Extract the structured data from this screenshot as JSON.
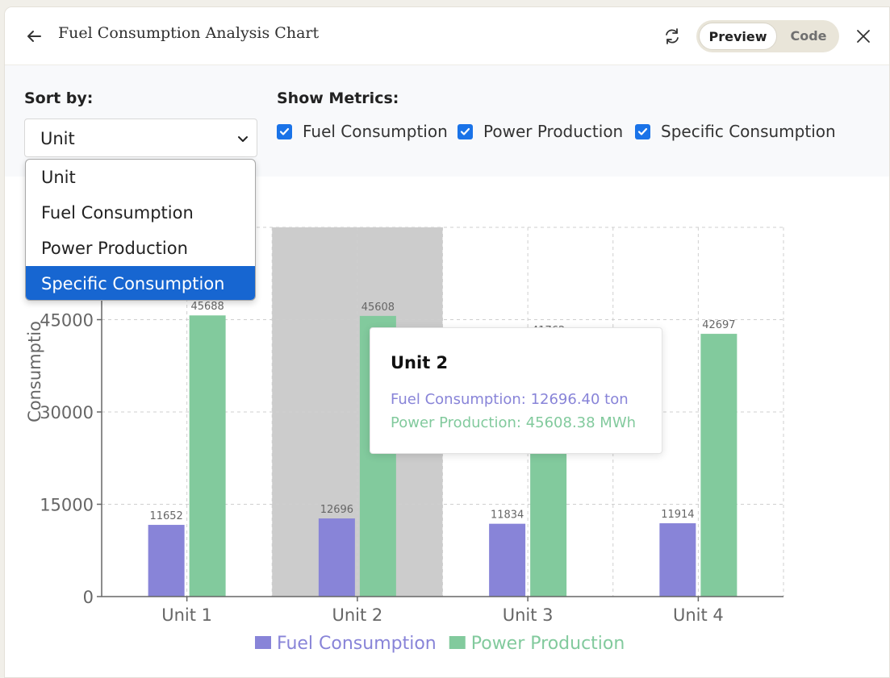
{
  "header": {
    "title": "Fuel Consumption Analysis Chart",
    "toggle": {
      "preview": "Preview",
      "code": "Code"
    }
  },
  "controls": {
    "sort_label": "Sort by:",
    "sort_value": "Unit",
    "sort_options": [
      "Unit",
      "Fuel Consumption",
      "Power Production",
      "Specific Consumption"
    ],
    "highlighted_option": "Specific Consumption",
    "metrics_label": "Show Metrics:",
    "metrics": [
      {
        "label": "Fuel Consumption",
        "checked": true
      },
      {
        "label": "Power Production",
        "checked": true
      },
      {
        "label": "Specific Consumption",
        "checked": true
      }
    ]
  },
  "tooltip": {
    "title": "Unit 2",
    "fuel_line": "Fuel Consumption: 12696.40 ton",
    "power_line": "Power Production: 45608.38 MWh"
  },
  "chart_data": {
    "type": "bar",
    "categories": [
      "Unit 1",
      "Unit 2",
      "Unit 3",
      "Unit 4"
    ],
    "series": [
      {
        "name": "Fuel Consumption",
        "color": "#8884d8",
        "values": [
          11652,
          12696,
          11834,
          11914
        ]
      },
      {
        "name": "Power Production",
        "color": "#82ca9d",
        "values": [
          45688,
          45608,
          41762,
          42697
        ]
      }
    ],
    "y_ticks": [
      0,
      15000,
      30000,
      45000
    ],
    "ylim": [
      0,
      60000
    ],
    "ylabel": "Consumptio",
    "grid": true,
    "highlighted_category": "Unit 2",
    "legend_position": "bottom"
  }
}
